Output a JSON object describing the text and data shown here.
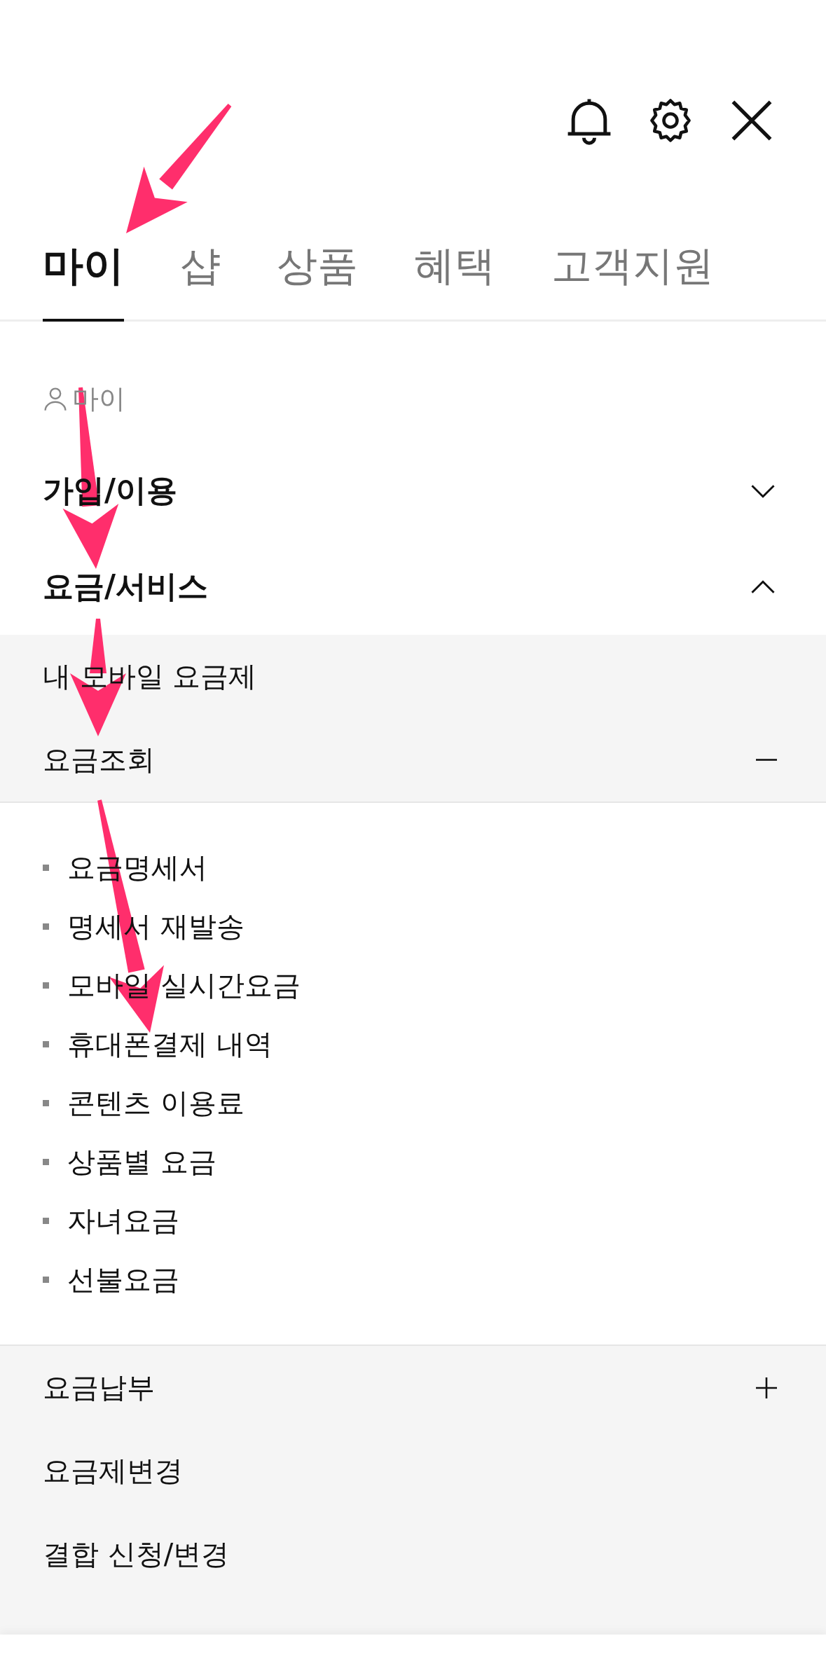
{
  "tabs": [
    {
      "label": "마이",
      "selected": true
    },
    {
      "label": "샵",
      "selected": false
    },
    {
      "label": "상품",
      "selected": false
    },
    {
      "label": "혜택",
      "selected": false
    },
    {
      "label": "고객지원",
      "selected": false
    }
  ],
  "breadcrumb": "마이",
  "sections": [
    {
      "label": "가입/이용",
      "expanded": false
    },
    {
      "label": "요금/서비스",
      "expanded": true,
      "items": [
        {
          "label": "내 모바일 요금제",
          "kind": "link"
        },
        {
          "label": "요금조회",
          "kind": "group",
          "expanded": true,
          "children": [
            "요금명세서",
            "명세서 재발송",
            "모바일 실시간요금",
            "휴대폰결제 내역",
            "콘텐츠 이용료",
            "상품별 요금",
            "자녀요금",
            "선불요금"
          ]
        },
        {
          "label": "요금납부",
          "kind": "group",
          "expanded": false
        },
        {
          "label": "요금제변경",
          "kind": "link"
        },
        {
          "label": "결합 신청/변경",
          "kind": "link"
        }
      ]
    }
  ]
}
